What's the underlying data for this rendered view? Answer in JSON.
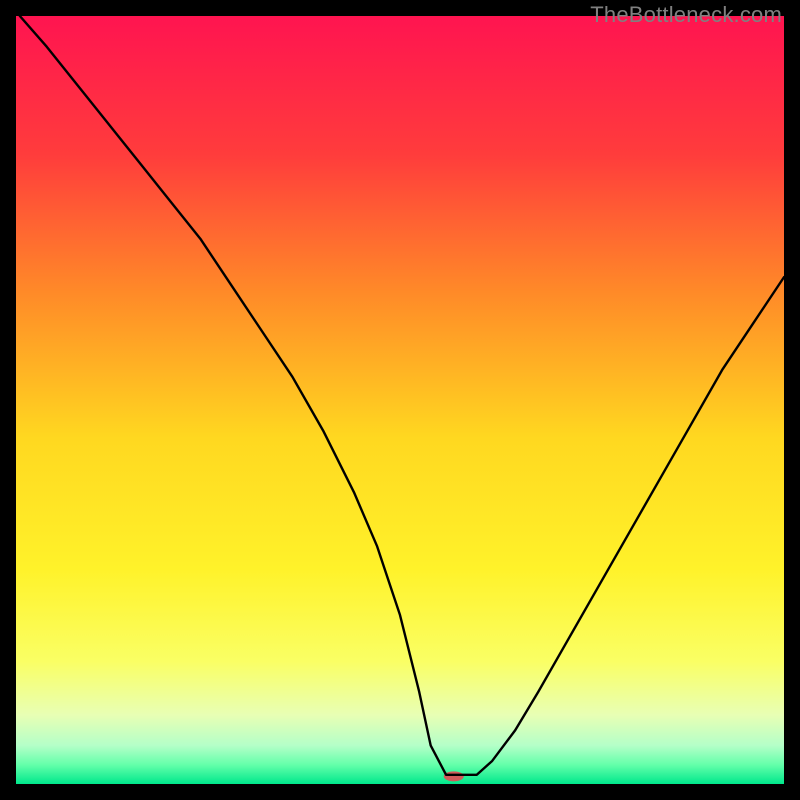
{
  "watermark": "TheBottleneck.com",
  "chart_data": {
    "type": "line",
    "title": "",
    "xlabel": "",
    "ylabel": "",
    "xlim": [
      0,
      100
    ],
    "ylim": [
      0,
      100
    ],
    "grid": false,
    "legend": false,
    "background_gradient_stops": [
      {
        "offset": 0.0,
        "color": "#ff1450"
      },
      {
        "offset": 0.18,
        "color": "#ff3c3c"
      },
      {
        "offset": 0.36,
        "color": "#ff8a28"
      },
      {
        "offset": 0.55,
        "color": "#ffd820"
      },
      {
        "offset": 0.72,
        "color": "#fff22a"
      },
      {
        "offset": 0.84,
        "color": "#faff64"
      },
      {
        "offset": 0.91,
        "color": "#e8ffb4"
      },
      {
        "offset": 0.95,
        "color": "#b4ffc8"
      },
      {
        "offset": 0.975,
        "color": "#64ffaa"
      },
      {
        "offset": 1.0,
        "color": "#00e88c"
      }
    ],
    "marker": {
      "x": 57,
      "y": 1,
      "color": "#d05a5a",
      "rx": 10,
      "ry": 5
    },
    "series": [
      {
        "name": "bottleneck-curve",
        "color": "#000000",
        "width": 2.4,
        "x": [
          0.5,
          4,
          8,
          12,
          16,
          20,
          24,
          28,
          32,
          36,
          40,
          44,
          47,
          50,
          52.5,
          54,
          56,
          58,
          60,
          62,
          65,
          68,
          72,
          76,
          80,
          84,
          88,
          92,
          96,
          100
        ],
        "y": [
          100,
          96,
          91,
          86,
          81,
          76,
          71,
          65,
          59,
          53,
          46,
          38,
          31,
          22,
          12,
          5,
          1.2,
          1.2,
          1.2,
          3,
          7,
          12,
          19,
          26,
          33,
          40,
          47,
          54,
          60,
          66
        ]
      }
    ]
  }
}
